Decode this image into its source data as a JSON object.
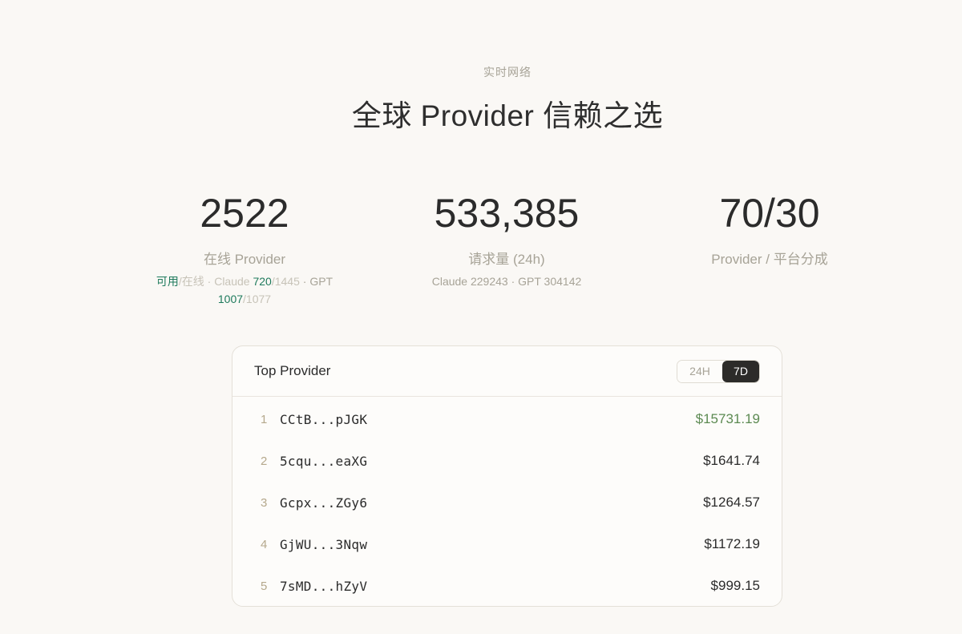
{
  "hero": {
    "eyebrow": "实时网络",
    "title": "全球 Provider 信赖之选"
  },
  "stats": {
    "online": {
      "value": "2522",
      "label": "在线 Provider",
      "avail_label": "可用",
      "online_label": "/在线 · Claude ",
      "claude_avail": "720",
      "claude_total": "/1445",
      "gpt_label": " · GPT ",
      "gpt_avail": "1007",
      "gpt_total": "/1077"
    },
    "requests": {
      "value": "533,385",
      "label": "请求量 (24h)",
      "detail": "Claude 229243 · GPT 304142"
    },
    "split": {
      "value": "70/30",
      "label": "Provider / 平台分成"
    }
  },
  "leaderboard": {
    "title": "Top Provider",
    "tabs": [
      {
        "label": "24H",
        "active": false
      },
      {
        "label": "7D",
        "active": true
      }
    ],
    "rows": [
      {
        "rank": "1",
        "address": "CCtB...pJGK",
        "amount": "$15731.19"
      },
      {
        "rank": "2",
        "address": "5cqu...eaXG",
        "amount": "$1641.74"
      },
      {
        "rank": "3",
        "address": "Gcpx...ZGy6",
        "amount": "$1264.57"
      },
      {
        "rank": "4",
        "address": "GjWU...3Nqw",
        "amount": "$1172.19"
      },
      {
        "rank": "5",
        "address": "7sMD...hZyV",
        "amount": "$999.15"
      }
    ]
  },
  "colors": {
    "background": "#faf8f5",
    "available_green": "#1e7a5c",
    "top_amount_green": "#5c8a52",
    "active_tab": "#2c2b29"
  }
}
